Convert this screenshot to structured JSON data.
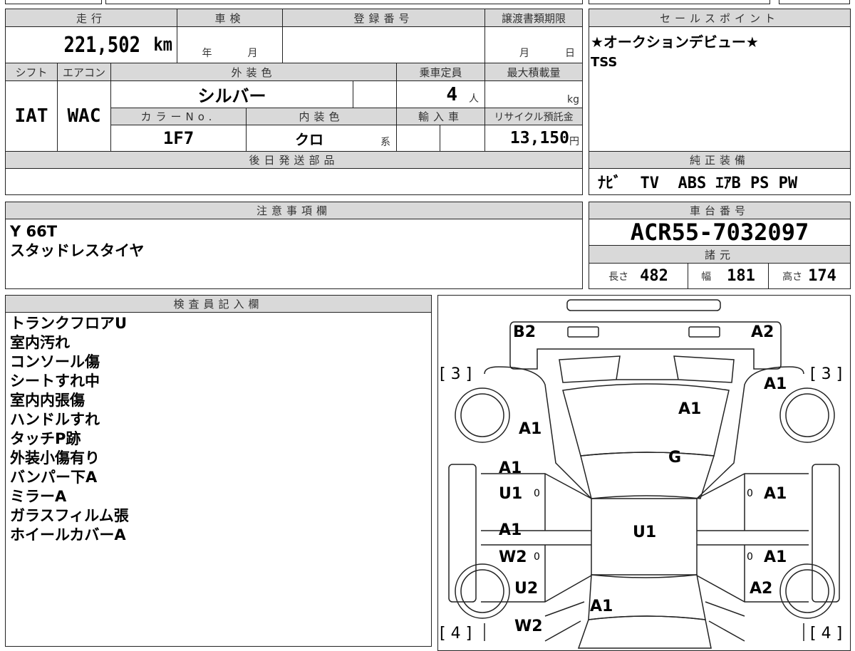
{
  "main": {
    "mileage_label": "走行",
    "mileage": "221,502",
    "mileage_unit": "km",
    "inspection_label": "車検",
    "inspection_year": "年",
    "inspection_month": "月",
    "registration_label": "登録番号",
    "transfer_label": "譲渡書類期限",
    "transfer_month": "月",
    "transfer_day": "日",
    "shift_label": "シフト",
    "shift": "IAT",
    "ac_label": "エアコン",
    "ac": "WAC",
    "exterior_label": "外装色",
    "exterior": "シルバー",
    "capacity_label": "乗車定員",
    "capacity": "4",
    "capacity_unit": "人",
    "load_label": "最大積載量",
    "load_unit": "kg",
    "color_no_label": "カラーNo.",
    "color_no": "1F7",
    "interior_label": "内装色",
    "interior": "クロ",
    "interior_suffix": "系",
    "import_label": "輸入車",
    "recycle_label": "リサイクル預託金",
    "recycle": "13,150",
    "recycle_unit": "円",
    "later_parts_label": "後日発送部品"
  },
  "notes": {
    "label": "注意事項欄",
    "lines": [
      "Y 66T",
      "スタッドレスタイヤ"
    ]
  },
  "sales_point": {
    "label": "セールスポイント",
    "lines": [
      "★オークションデビュー★",
      "TSS"
    ]
  },
  "equipment": {
    "label": "純正装備",
    "items": "ﾅﾋﾞ  TV  ABS ｴｱB PS PW"
  },
  "chassis": {
    "label": "車台番号",
    "value": "ACR55-7032097"
  },
  "specs": {
    "label": "諸元",
    "length_label": "長さ",
    "length": "482",
    "width_label": "幅",
    "width": "181",
    "height_label": "高さ",
    "height": "174"
  },
  "inspector": {
    "label": "検査員記入欄",
    "lines": [
      "トランクフロアU",
      "室内汚れ",
      "コンソール傷",
      "シートすれ中",
      "室内内張傷",
      "ハンドルすれ",
      "タッチP跡",
      "外装小傷有り",
      "バンパー下A",
      "ミラーA",
      "ガラスフィルム張",
      "ホイールカバーA"
    ]
  },
  "diagram": {
    "labels": [
      "B2",
      "A2",
      "[ 3 ]",
      "[ 3 ]",
      "A1",
      "A1",
      "A1",
      "G",
      "A1",
      "U1",
      "0",
      "0",
      "A1",
      "A1",
      "U1",
      "W2",
      "0",
      "0",
      "A1",
      "U2",
      "A2",
      "A1",
      "[ 4 ]",
      "W2",
      "[ 4 ]"
    ]
  }
}
